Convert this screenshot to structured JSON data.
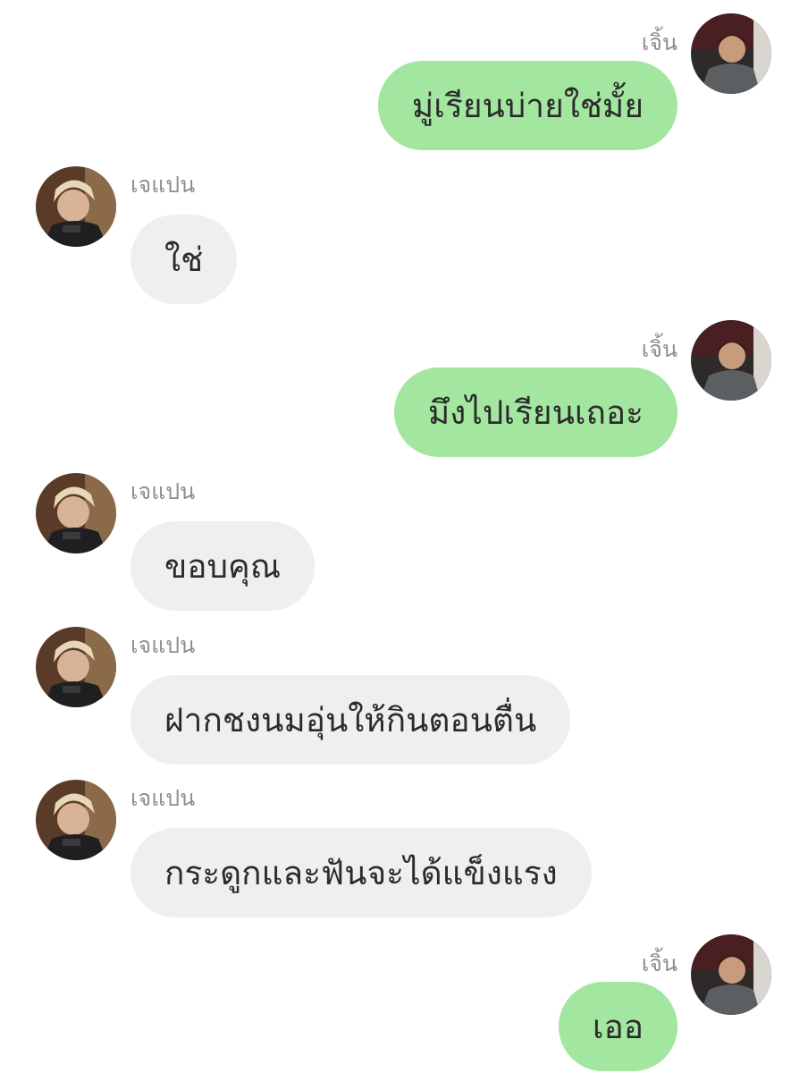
{
  "messages": [
    {
      "side": "right",
      "sender": "เจิ้น",
      "text": "มู่เรียนบ่ายใช่มั้ย"
    },
    {
      "side": "left",
      "sender": "เจแปน",
      "text": "ใช่"
    },
    {
      "side": "right",
      "sender": "เจิ้น",
      "text": "มึงไปเรียนเถอะ"
    },
    {
      "side": "left",
      "sender": "เจแปน",
      "text": "ขอบคุณ"
    },
    {
      "side": "left",
      "sender": "เจแปน",
      "text": "ฝากชงนมอุ่นให้กินตอนตื่น"
    },
    {
      "side": "left",
      "sender": "เจแปน",
      "text": "กระดูกและฟันจะได้แข็งแรง"
    },
    {
      "side": "right",
      "sender": "เจิ้น",
      "text": "เออ"
    }
  ],
  "colors": {
    "outgoing_bubble": "#a2e69f",
    "incoming_bubble": "#efefef",
    "name_text": "#8e8e8e",
    "message_text": "#2b2b2b"
  }
}
